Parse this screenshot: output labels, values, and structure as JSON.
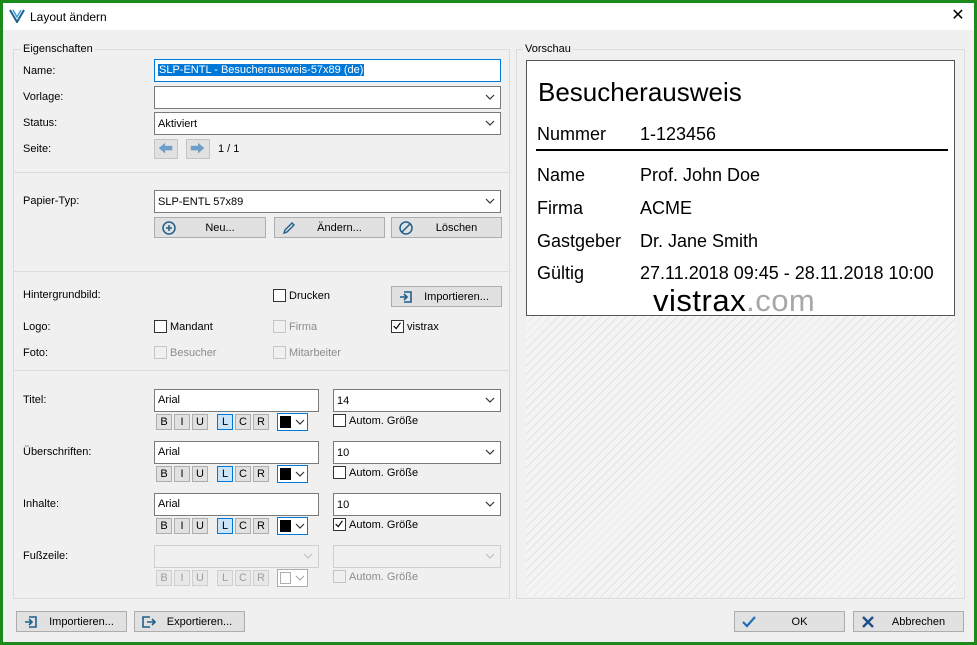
{
  "window": {
    "title": "Layout ändern",
    "close_glyph": "✕"
  },
  "properties": {
    "group_label": "Eigenschaften",
    "name_label": "Name:",
    "name_value": "SLP-ENTL - Besucherausweis-57x89 (de)",
    "template_label": "Vorlage:",
    "template_value": "",
    "status_label": "Status:",
    "status_value": "Aktiviert",
    "page_label": "Seite:",
    "page_value": "1 / 1"
  },
  "paper": {
    "label": "Papier-Typ:",
    "value": "SLP-ENTL 57x89",
    "new_label": "Neu...",
    "edit_label": "Ändern...",
    "delete_label": "Löschen"
  },
  "images": {
    "background_label": "Hintergrundbild:",
    "print_label": "Drucken",
    "print_checked": false,
    "import_label": "Importieren...",
    "logo_label": "Logo:",
    "mandant_label": "Mandant",
    "mandant_checked": false,
    "firma_label": "Firma",
    "firma_checked": false,
    "vistrax_label": "vistrax",
    "vistrax_checked": true,
    "photo_label": "Foto:",
    "visitor_label": "Besucher",
    "employee_label": "Mitarbeiter"
  },
  "fonts": {
    "autosize_label": "Autom. Größe",
    "bold": "B",
    "italic": "I",
    "underline": "U",
    "align_left": "L",
    "align_center": "C",
    "align_right": "R",
    "rows": [
      {
        "label": "Titel:",
        "font": "Arial",
        "size": "14",
        "autosize": false,
        "enabled": true,
        "color": "#000000"
      },
      {
        "label": "Überschriften:",
        "font": "Arial",
        "size": "10",
        "autosize": false,
        "enabled": true,
        "color": "#000000"
      },
      {
        "label": "Inhalte:",
        "font": "Arial",
        "size": "10",
        "autosize": true,
        "enabled": true,
        "color": "#000000"
      },
      {
        "label": "Fußzeile:",
        "font": "",
        "size": "",
        "autosize": false,
        "enabled": false,
        "color": "#ffffff"
      }
    ]
  },
  "preview": {
    "label": "Vorschau",
    "title": "Besucherausweis",
    "number_label": "Nummer",
    "number_value": "1-123456",
    "fields": [
      {
        "label": "Name",
        "value": "Prof. John Doe"
      },
      {
        "label": "Firma",
        "value": "ACME"
      },
      {
        "label": "Gastgeber",
        "value": "Dr. Jane Smith"
      },
      {
        "label": "Gültig",
        "value": "27.11.2018 09:45 - 28.11.2018 10:00"
      }
    ],
    "logo_main": "vistrax",
    "logo_domain": ".com"
  },
  "footer": {
    "import_label": "Importieren...",
    "export_label": "Exportieren...",
    "ok_label": "OK",
    "cancel_label": "Abbrechen"
  },
  "colors": {
    "accent": "#0078d7",
    "frame": "#1a8a1a",
    "icon_blue": "#1e5f8c",
    "ok_check": "#1e6fb8",
    "cancel_x": "#1e4f8c"
  },
  "icons": {
    "app": "vistrax-logo-icon",
    "close": "close-icon",
    "chevron": "chevron-down-icon",
    "prev": "arrow-left-icon",
    "next": "arrow-right-icon",
    "add": "plus-circle-icon",
    "edit": "pencil-icon",
    "delete": "no-entry-icon",
    "import": "import-icon",
    "export": "export-icon",
    "ok": "checkmark-icon",
    "cancel": "x-icon"
  }
}
